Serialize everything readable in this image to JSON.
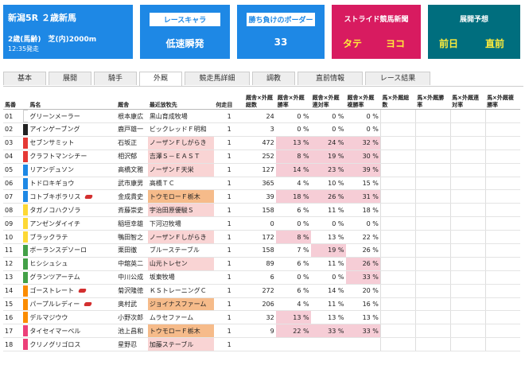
{
  "race": {
    "title": "新潟5R ２歳新馬",
    "condition": "2歳(馬齢)　芝(内)2000m",
    "time": "12:35発走"
  },
  "race_chara": {
    "label": "レースキャラ",
    "value": "低速瞬発"
  },
  "border": {
    "label": "勝ち負けのボーダー",
    "value": "33"
  },
  "stride": {
    "label": "ストライド競馬新聞",
    "left": "タテ",
    "right": "ヨコ"
  },
  "forecast": {
    "label": "展開予想",
    "left": "前日",
    "right": "直前"
  },
  "tabs": [
    "基本",
    "展開",
    "騎手",
    "外厩",
    "競走馬詳細",
    "調教",
    "直前情報",
    "レース結果"
  ],
  "active_tab": 3,
  "headers": {
    "no": "馬番",
    "name": "馬名",
    "owner": "厩舎",
    "facility": "最近放牧先",
    "count": "何走目",
    "runs": "厩舎×外厩総数",
    "win": "厩舎×外厩勝率",
    "place2": "厩舎×外厩連対率",
    "place3": "厩舎×外厩複勝率",
    "h_runs": "馬×外厩総数",
    "h_win": "馬×外厩勝率",
    "h_place2": "馬×外厩連対率",
    "h_place3": "馬×外厩複勝率"
  },
  "colors": {
    "waku1": "#ffffff",
    "waku2": "#222222",
    "waku3": "#e53935",
    "waku4": "#1e88e5",
    "waku5": "#fdd835",
    "waku6": "#43a047",
    "waku7": "#fb8c00",
    "waku8": "#ec407a",
    "highlight": "#f6cdd6"
  },
  "rows": [
    {
      "no": "01",
      "name": "グリーンメーラー",
      "owner": "根本康広",
      "facility": "黒山育成牧場",
      "count": "1",
      "runs": "24",
      "win": "0 %",
      "place2": "0 %",
      "place3": "0 %",
      "flag": false,
      "fh": 0,
      "hl": []
    },
    {
      "no": "02",
      "name": "アインゲーブング",
      "owner": "鹿戸雄一",
      "facility": "ビックレッドＦ明和",
      "count": "1",
      "runs": "3",
      "win": "0 %",
      "place2": "0 %",
      "place3": "0 %",
      "flag": false,
      "fh": 0,
      "hl": []
    },
    {
      "no": "03",
      "name": "セブンサミット",
      "owner": "石坂正",
      "facility": "ノーザンＦしがらき",
      "count": "1",
      "runs": "472",
      "win": "13 %",
      "place2": "24 %",
      "place3": "32 %",
      "flag": false,
      "fh": 1,
      "hl": [
        "win",
        "place2",
        "place3"
      ]
    },
    {
      "no": "04",
      "name": "クラフトマンシチー",
      "owner": "相沢郁",
      "facility": "吉澤Ｓ－ＥＡＳＴ",
      "count": "1",
      "runs": "252",
      "win": "8 %",
      "place2": "19 %",
      "place3": "30 %",
      "flag": false,
      "fh": 1,
      "hl": [
        "win",
        "place2",
        "place3"
      ]
    },
    {
      "no": "05",
      "name": "リアンデュソン",
      "owner": "高橋文雅",
      "facility": "ノーザンＦ天栄",
      "count": "1",
      "runs": "127",
      "win": "14 %",
      "place2": "23 %",
      "place3": "39 %",
      "flag": false,
      "fh": 1,
      "hl": [
        "win",
        "place2",
        "place3"
      ]
    },
    {
      "no": "06",
      "name": "トドロキギョウ",
      "owner": "武市康男",
      "facility": "高橋ＴＣ",
      "count": "1",
      "runs": "365",
      "win": "4 %",
      "place2": "10 %",
      "place3": "15 %",
      "flag": false,
      "fh": 0,
      "hl": []
    },
    {
      "no": "07",
      "name": "コトブキボラリス",
      "owner": "金成貴史",
      "facility": "トウモローＦ栃木",
      "count": "1",
      "runs": "39",
      "win": "18 %",
      "place2": "26 %",
      "place3": "31 %",
      "flag": true,
      "fh": 2,
      "hl": [
        "win",
        "place2",
        "place3"
      ]
    },
    {
      "no": "08",
      "name": "タガノコハクゾラ",
      "owner": "斉藤崇史",
      "facility": "宇治田原優駿Ｓ",
      "count": "1",
      "runs": "158",
      "win": "6 %",
      "place2": "11 %",
      "place3": "18 %",
      "flag": false,
      "fh": 1,
      "hl": []
    },
    {
      "no": "09",
      "name": "アンゼンダイイチ",
      "owner": "稲垣幸雄",
      "facility": "下河辺牧場",
      "count": "1",
      "runs": "0",
      "win": "0 %",
      "place2": "0 %",
      "place3": "0 %",
      "flag": false,
      "fh": 0,
      "hl": []
    },
    {
      "no": "10",
      "name": "ブラックラテ",
      "owner": "鴨田智之",
      "facility": "ノーザンＦしがらき",
      "count": "1",
      "runs": "172",
      "win": "8 %",
      "place2": "13 %",
      "place3": "22 %",
      "flag": false,
      "fh": 1,
      "hl": [
        "win"
      ]
    },
    {
      "no": "11",
      "name": "ボーランスデソーロ",
      "owner": "栗田徹",
      "facility": "ブルーステーブル",
      "count": "1",
      "runs": "158",
      "win": "7 %",
      "place2": "19 %",
      "place3": "26 %",
      "flag": false,
      "fh": 0,
      "hl": [
        "place2"
      ]
    },
    {
      "no": "12",
      "name": "ヒシシュシュ",
      "owner": "中舘英二",
      "facility": "山元トレセン",
      "count": "1",
      "runs": "89",
      "win": "6 %",
      "place2": "11 %",
      "place3": "26 %",
      "flag": false,
      "fh": 1,
      "hl": [
        "place3"
      ]
    },
    {
      "no": "13",
      "name": "グランツアーテム",
      "owner": "中川公成",
      "facility": "坂東牧場",
      "count": "1",
      "runs": "6",
      "win": "0 %",
      "place2": "0 %",
      "place3": "33 %",
      "flag": false,
      "fh": 0,
      "hl": [
        "place3"
      ]
    },
    {
      "no": "14",
      "name": "ゴーストレート",
      "owner": "菊沢隆徳",
      "facility": "ＫＳトレーニングＣ",
      "count": "1",
      "runs": "272",
      "win": "6 %",
      "place2": "14 %",
      "place3": "20 %",
      "flag": true,
      "fh": 0,
      "hl": []
    },
    {
      "no": "15",
      "name": "パープルレディー",
      "owner": "奥村武",
      "facility": "ジョイナスファーム",
      "count": "1",
      "runs": "206",
      "win": "4 %",
      "place2": "11 %",
      "place3": "16 %",
      "flag": true,
      "fh": 2,
      "hl": []
    },
    {
      "no": "16",
      "name": "デルマジウウ",
      "owner": "小野次郎",
      "facility": "ムラセファーム",
      "count": "1",
      "runs": "32",
      "win": "13 %",
      "place2": "13 %",
      "place3": "13 %",
      "flag": false,
      "fh": 0,
      "hl": [
        "win"
      ]
    },
    {
      "no": "17",
      "name": "タイセイマーベル",
      "owner": "池上昌和",
      "facility": "トウモローＦ栃木",
      "count": "1",
      "runs": "9",
      "win": "22 %",
      "place2": "33 %",
      "place3": "33 %",
      "flag": false,
      "fh": 2,
      "hl": [
        "win",
        "place2",
        "place3"
      ]
    },
    {
      "no": "18",
      "name": "クリノグリゴロス",
      "owner": "星野忍",
      "facility": "加藤ステーブル",
      "count": "1",
      "runs": "",
      "win": "",
      "place2": "",
      "place3": "",
      "flag": false,
      "fh": 1,
      "hl": []
    }
  ]
}
